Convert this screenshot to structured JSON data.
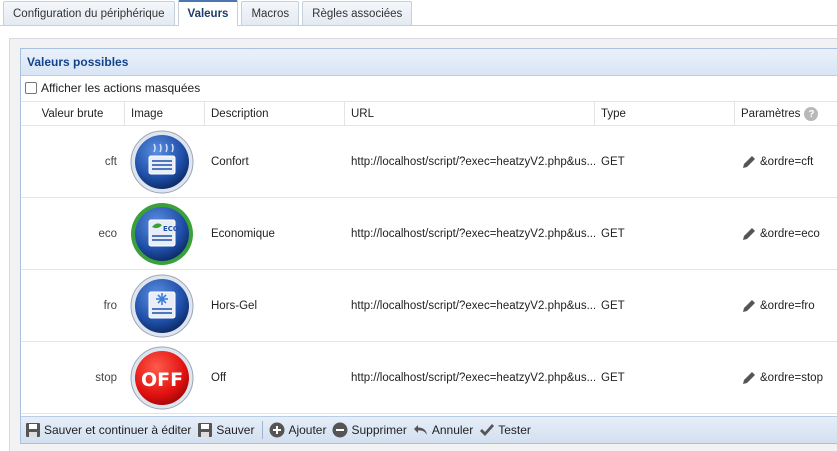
{
  "tabs": [
    {
      "label": "Configuration du périphérique",
      "active": false
    },
    {
      "label": "Valeurs",
      "active": true
    },
    {
      "label": "Macros",
      "active": false
    },
    {
      "label": "Règles associées",
      "active": false
    }
  ],
  "panel": {
    "title": "Valeurs possibles",
    "show_hidden_label": "Afficher les actions masquées"
  },
  "columns": {
    "raw": "Valeur brute",
    "image": "Image",
    "description": "Description",
    "url": "URL",
    "type": "Type",
    "params": "Paramètres"
  },
  "rows": [
    {
      "raw": "cft",
      "icon": "comfort-heater-icon",
      "description": "Confort",
      "url": "http://localhost/script/?exec=heatzyV2.php&us...",
      "type": "GET",
      "params": "&ordre=cft"
    },
    {
      "raw": "eco",
      "icon": "eco-heater-icon",
      "description": "Economique",
      "url": "http://localhost/script/?exec=heatzyV2.php&us...",
      "type": "GET",
      "params": "&ordre=eco"
    },
    {
      "raw": "fro",
      "icon": "frost-heater-icon",
      "description": "Hors-Gel",
      "url": "http://localhost/script/?exec=heatzyV2.php&us...",
      "type": "GET",
      "params": "&ordre=fro"
    },
    {
      "raw": "stop",
      "icon": "off-icon",
      "description": "Off",
      "url": "http://localhost/script/?exec=heatzyV2.php&us...",
      "type": "GET",
      "params": "&ordre=stop",
      "icon_text": "OFF"
    }
  ],
  "toolbar": {
    "save_continue": "Sauver et continuer à éditer",
    "save": "Sauver",
    "add": "Ajouter",
    "delete": "Supprimer",
    "cancel": "Annuler",
    "test": "Tester"
  },
  "colors": {
    "accent": "#15428b",
    "header_bg": "#d8e5f5",
    "off_red": "#e01010",
    "eco_green": "#3aa13a",
    "device_blue": "#1f4fa8"
  }
}
